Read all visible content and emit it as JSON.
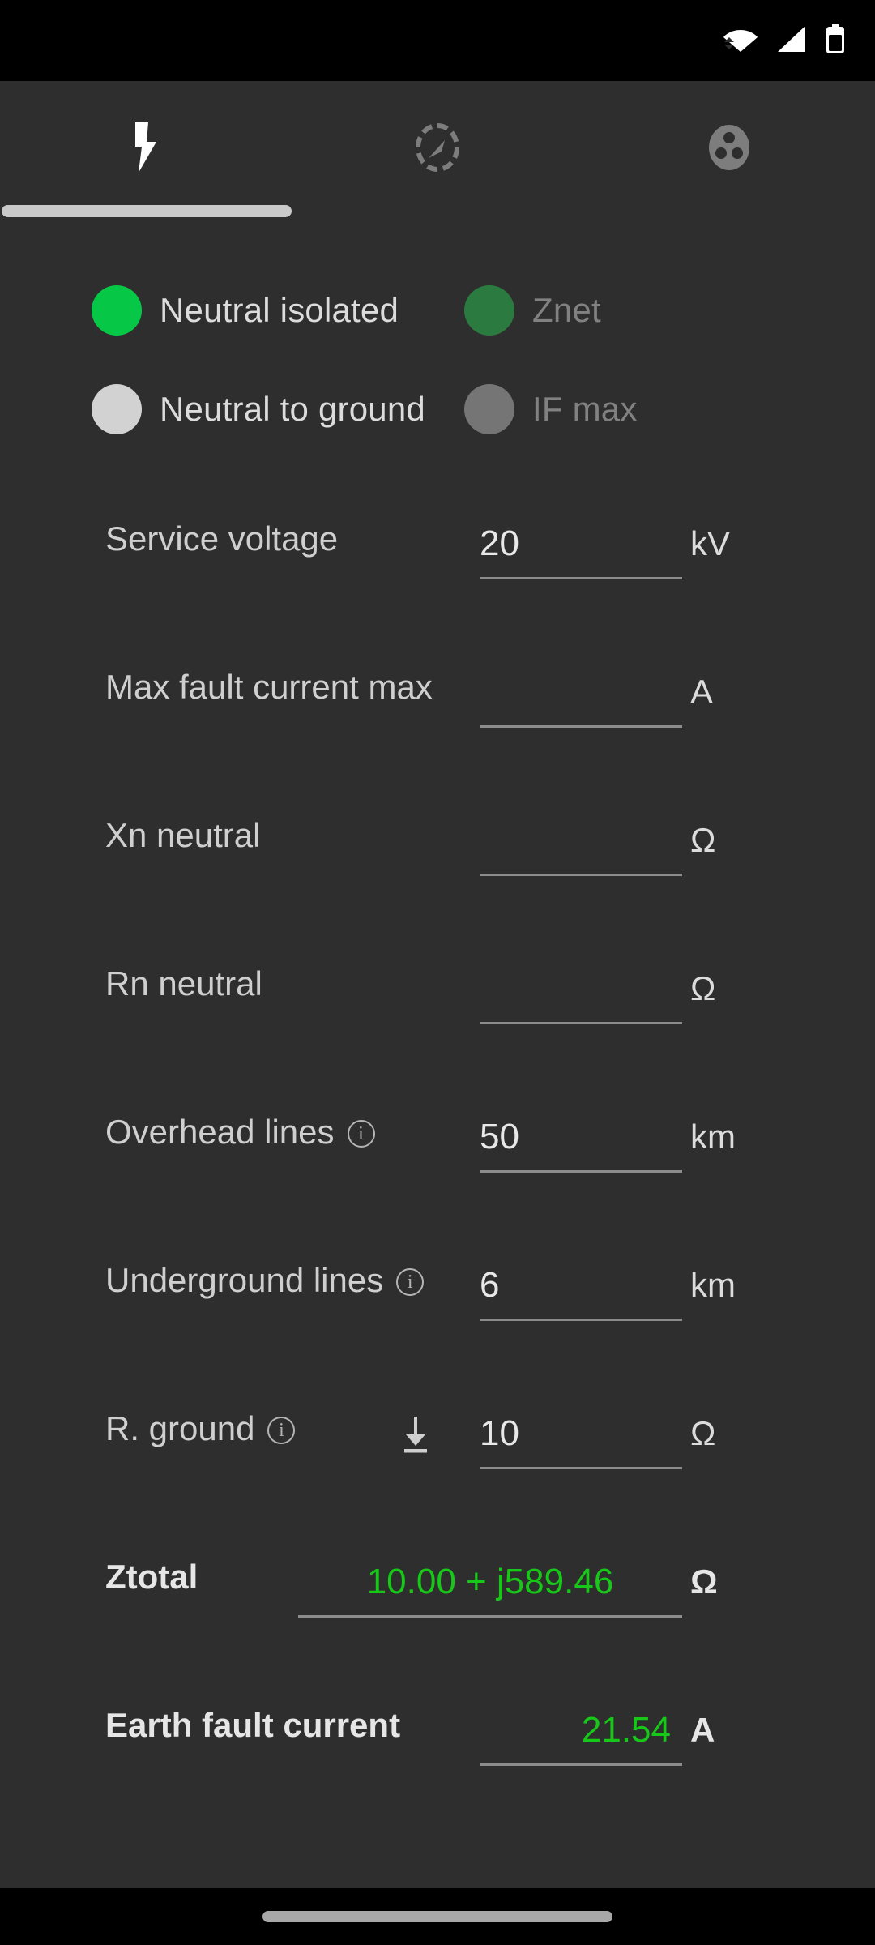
{
  "statusbar": {
    "icons": [
      "wifi-icon",
      "cell-signal-icon",
      "battery-icon"
    ]
  },
  "tabs": [
    {
      "name": "tab-fault-calculator",
      "icon": "lightning-bolt-icon",
      "active": true
    },
    {
      "name": "tab-gauge",
      "icon": "gauge-icon",
      "active": false
    },
    {
      "name": "tab-socket",
      "icon": "power-socket-icon",
      "active": false
    }
  ],
  "options": {
    "rows": [
      {
        "left": {
          "label": "Neutral isolated",
          "selected": true,
          "color": "#07c846"
        },
        "right": {
          "label": "Znet",
          "selected": true,
          "color": "#2b7b41"
        }
      },
      {
        "left": {
          "label": "Neutral to ground",
          "selected": false,
          "color": "#d2d2d2"
        },
        "right": {
          "label": "IF max",
          "selected": false,
          "color": "#757575"
        }
      }
    ]
  },
  "form": {
    "fields": [
      {
        "label": "Service voltage",
        "value": "20",
        "unit": "kV",
        "info": false,
        "ground": false,
        "result": false
      },
      {
        "label": "Max fault current max",
        "value": "",
        "unit": "A",
        "info": false,
        "ground": false,
        "result": false
      },
      {
        "label": "Xn neutral",
        "value": "",
        "unit": "Ω",
        "info": false,
        "ground": false,
        "result": false
      },
      {
        "label": "Rn neutral",
        "value": "",
        "unit": "Ω",
        "info": false,
        "ground": false,
        "result": false
      },
      {
        "label": "Overhead lines",
        "value": "50",
        "unit": "km",
        "info": true,
        "ground": false,
        "result": false
      },
      {
        "label": "Underground lines",
        "value": "6",
        "unit": "km",
        "info": true,
        "ground": false,
        "result": false
      },
      {
        "label": "R. ground",
        "value": "10",
        "unit": "Ω",
        "info": true,
        "ground": true,
        "result": false
      }
    ],
    "results": [
      {
        "label": "Ztotal",
        "value": "10.00 + j589.46",
        "unit": "Ω",
        "wide": true
      },
      {
        "label": "Earth fault current",
        "value": "21.54",
        "unit": "A",
        "wide": false
      }
    ]
  },
  "colors": {
    "background": "#2e2e2e",
    "accent_green": "#07c846",
    "result_green": "#17c818",
    "text_primary": "#dcdcdc",
    "text_dim": "#818181",
    "underline": "#8c8c8c"
  },
  "labels": {
    "info_glyph": "i"
  }
}
